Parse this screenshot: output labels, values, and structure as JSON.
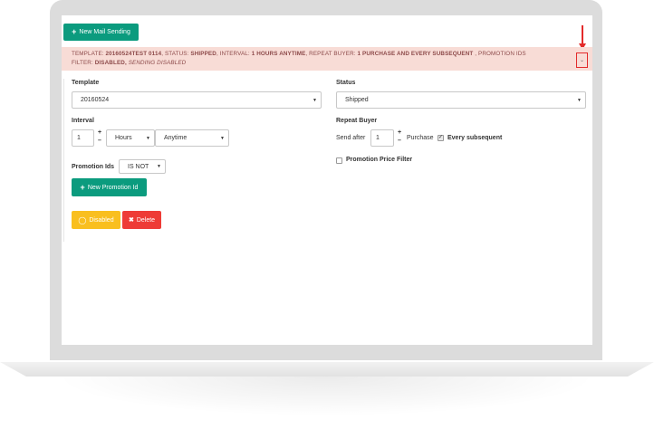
{
  "toolbar": {
    "new_mail_sending_label": "New Mail Sending"
  },
  "info": {
    "template_label": "TEMPLATE:",
    "template_value": "20160524TEST 0114",
    "status_label": ", STATUS:",
    "status_value": "SHIPPED",
    "interval_label": ", INTERVAL:",
    "interval_value": "1 HOURS ANYTIME",
    "repeat_label": ", REPEAT BUYER:",
    "repeat_value": "1 PURCHASE AND EVERY SUBSEQUENT",
    "promotion_label": " , PROMOTION IDS",
    "filter_label": "FILTER:",
    "filter_value": "DISABLED,",
    "sending_value": "SENDING DISABLED"
  },
  "form": {
    "template_label": "Template",
    "template_value": "20160524",
    "status_label": "Status",
    "status_value": "Shipped",
    "interval_label": "Interval",
    "interval_value": "1",
    "interval_unit": "Hours",
    "interval_time": "Anytime",
    "repeat_buyer_label": "Repeat Buyer",
    "send_after_label": "Send after",
    "send_after_value": "1",
    "purchase_label": "Purchase",
    "every_subsequent_label": "Every subsequent",
    "every_subsequent_checked": true,
    "promotion_ids_label": "Promotion Ids",
    "promotion_ids_operator": "IS NOT",
    "promotion_price_filter_label": "Promotion Price Filter",
    "promotion_price_filter_checked": false,
    "new_promotion_id_label": "New Promotion Id"
  },
  "actions": {
    "disabled_label": "Disabled",
    "delete_label": "Delete"
  },
  "colors": {
    "accent": "#0b9b7e",
    "banner_bg": "#f8dcd6",
    "warning": "#f9bf1f",
    "danger": "#ee3b36"
  },
  "icons": [
    "plus-icon",
    "chevron-down-icon",
    "toggle-icon",
    "close-icon",
    "checkmark-icon"
  ]
}
